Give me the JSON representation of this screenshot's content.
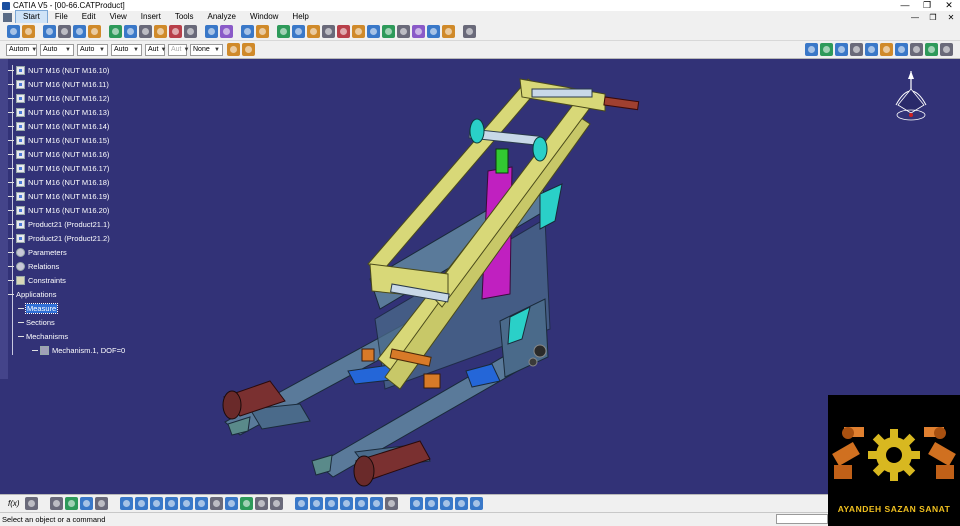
{
  "window": {
    "title": "CATIA V5 - [00-66.CATProduct]",
    "minimize": "—",
    "restore": "❐",
    "close": "✕"
  },
  "menu": {
    "items": [
      "Start",
      "File",
      "Edit",
      "View",
      "Insert",
      "Tools",
      "Analyze",
      "Window",
      "Help"
    ],
    "doc_minimize": "—",
    "doc_restore": "❐",
    "doc_close": "✕"
  },
  "toolbar2": {
    "selects": [
      "Autom",
      "Auto",
      "Auto",
      "Auto",
      "Aut",
      "Aut",
      "None"
    ]
  },
  "tree": {
    "items": [
      "NUT M16 (NUT M16.10)",
      "NUT M16 (NUT M16.11)",
      "NUT M16 (NUT M16.12)",
      "NUT M16 (NUT M16.13)",
      "NUT M16 (NUT M16.14)",
      "NUT M16 (NUT M16.15)",
      "NUT M16 (NUT M16.16)",
      "NUT M16 (NUT M16.17)",
      "NUT M16 (NUT M16.18)",
      "NUT M16 (NUT M16.19)",
      "NUT M16 (NUT M16.20)",
      "Product21 (Product21.1)",
      "Product21 (Product21.2)",
      "Parameters",
      "Relations",
      "Constraints",
      "Applications",
      "Measure",
      "Sections",
      "Mechanisms",
      "Mechanism.1, DOF=0"
    ]
  },
  "bottombar": {
    "fog_label": "f(x)"
  },
  "status": {
    "text": "Select an object or a command"
  },
  "logo": {
    "text": "AYANDEH SAZAN SANAT"
  },
  "colors": {
    "viewport_bg": "#323277",
    "beam_yellow": "#d8d878",
    "frame_slate": "#5a7a9a",
    "cylinder_magenta": "#c020c0",
    "accent_cyan": "#2ad0c8",
    "selection_blue": "#2f6fd6",
    "logo_gold": "#f0c020"
  }
}
